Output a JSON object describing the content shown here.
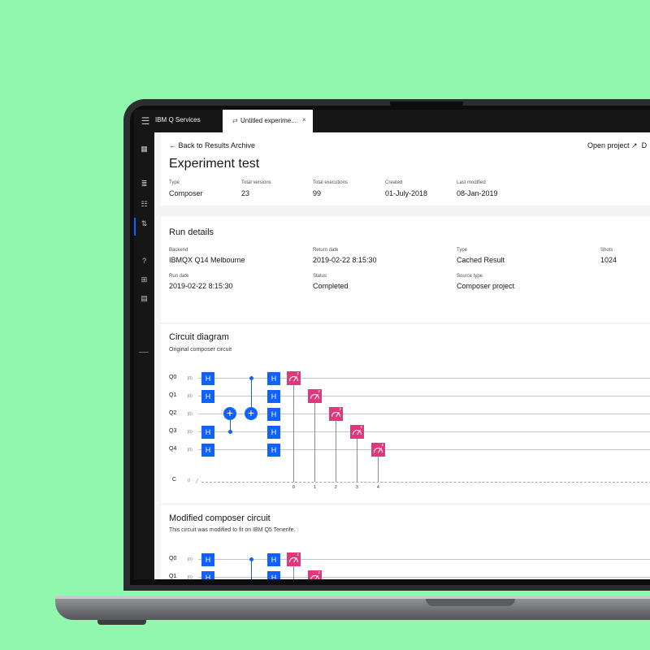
{
  "app": {
    "title": "IBM Q Services",
    "tab_label": "Untitled experime...",
    "tab_icon": "circuit-icon",
    "close_icon": "close-icon"
  },
  "header": {
    "back_link": "← Back to Results Archive",
    "open_project": "Open project ↗",
    "overflow_char": "D",
    "title": "Experiment test",
    "meta": [
      {
        "label": "Type",
        "value": "Composer"
      },
      {
        "label": "Total versions",
        "value": "23"
      },
      {
        "label": "Total executions",
        "value": "99"
      },
      {
        "label": "Created",
        "value": "01-July-2018"
      },
      {
        "label": "Last modified",
        "value": "08-Jan-2019"
      }
    ]
  },
  "run_details": {
    "title": "Run details",
    "backend": {
      "label": "Backend",
      "value": "IBMQX Q14 Melbourne"
    },
    "return_date": {
      "label": "Return date",
      "value": "2019-02-22 8:15:30"
    },
    "type": {
      "label": "Type",
      "value": "Cached Result"
    },
    "shots": {
      "label": "Shots",
      "value": "1024"
    },
    "run_date": {
      "label": "Run date",
      "value": "2019-02-22 8:15:30"
    },
    "status": {
      "label": "Status",
      "value": "Completed"
    },
    "source_type": {
      "label": "Source type",
      "value": "Composer project"
    }
  },
  "circuit": {
    "title": "Circuit diagram",
    "subtitle": "Original composer circuit",
    "qubits": [
      "Q0",
      "Q1",
      "Q2",
      "Q3",
      "Q4"
    ],
    "ket": "|0⟩",
    "classical": {
      "label": "C",
      "value": "0",
      "indices": [
        "0",
        "1",
        "2",
        "3",
        "4"
      ]
    },
    "h_gate": "H",
    "cnot_symbol": "+"
  },
  "modified": {
    "title": "Modified composer circuit",
    "subtitle": "This circuit was modified to fit on IBM Q5 Tenerife.",
    "qubits": [
      "Q0",
      "Q1"
    ]
  },
  "colors": {
    "accent": "#0f62fe",
    "measure": "#e4367a",
    "background": "#92f7ae"
  }
}
